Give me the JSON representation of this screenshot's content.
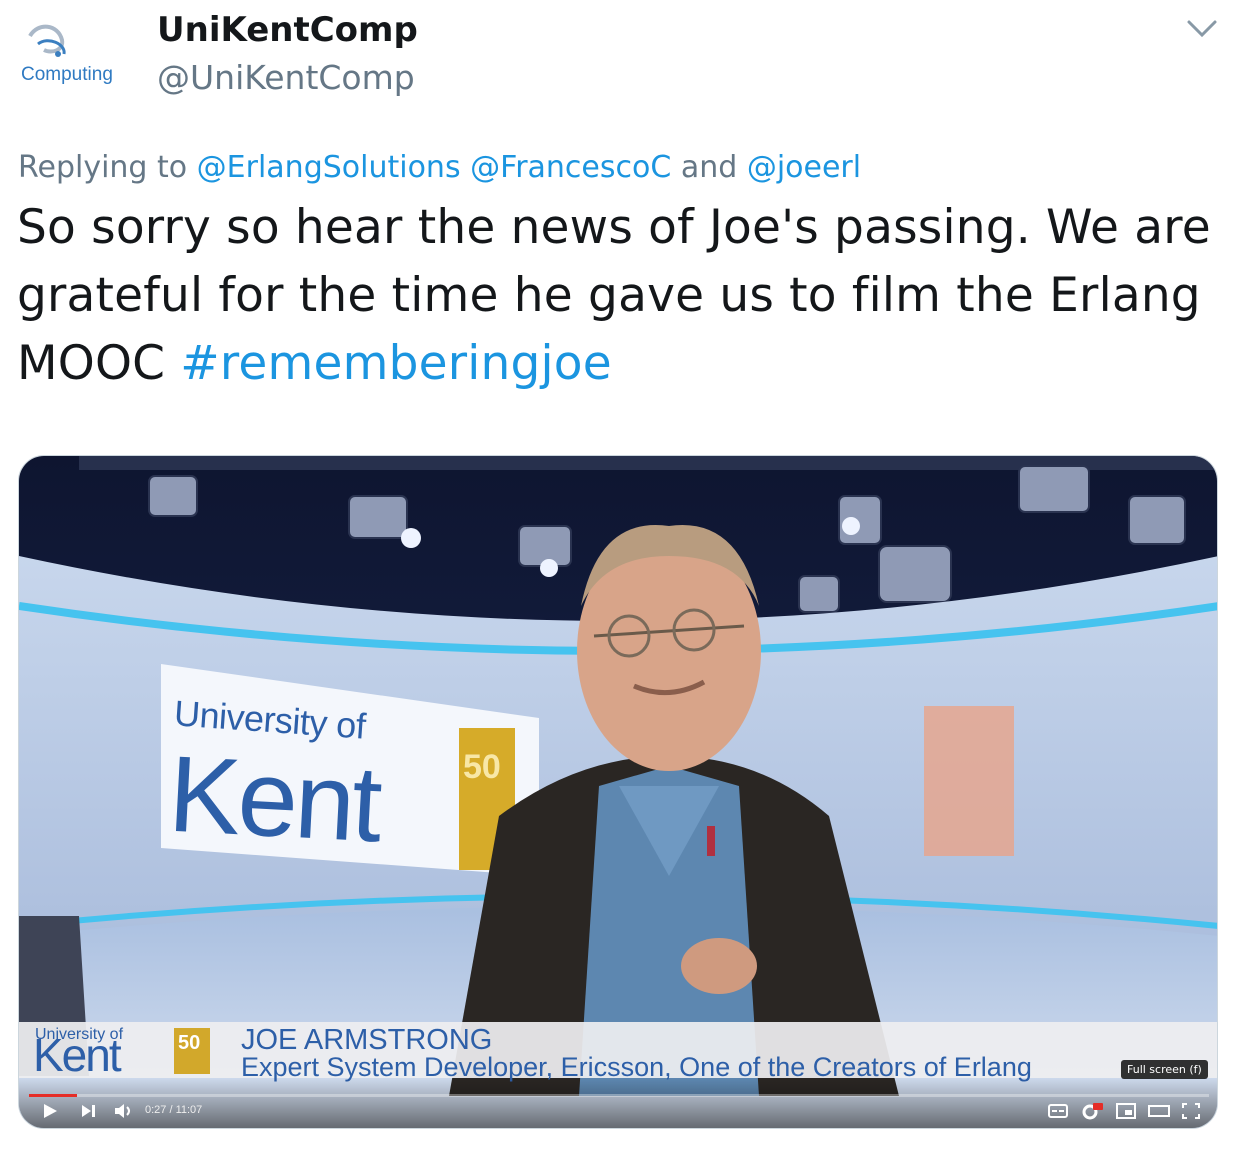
{
  "header": {
    "avatar_label": "Computing",
    "display_name": "UniKentComp",
    "handle": "@UniKentComp"
  },
  "reply": {
    "prefix": "Replying to ",
    "mentions": [
      "@ErlangSolutions",
      "@FrancescoC",
      "@joeerl"
    ],
    "joiner": " and "
  },
  "tweet": {
    "text": "So sorry so hear the news of Joe's passing. We are grateful for the time he gave us to film the Erlang MOOC ",
    "hashtag": "#rememberingjoe"
  },
  "video": {
    "sign_university": "University of",
    "sign_kent": "Kent",
    "sign_fifty": "50",
    "lower_third": {
      "univ": "University of",
      "kent": "Kent",
      "badge": "50",
      "name": "JOE ARMSTRONG",
      "title": "Expert System Developer, Ericsson, One of the Creators of Erlang"
    },
    "tooltip": "Full screen (f)",
    "time_readout": "0:27 / 11:07",
    "progress": 0.0405
  },
  "colors": {
    "link": "#1b95e0",
    "secondary_text": "#657786",
    "kent_blue": "#2d5fa8",
    "progress_red": "#e52d27"
  },
  "icons": [
    "chevron-down-icon",
    "play-icon",
    "next-icon",
    "volume-icon",
    "subtitles-icon",
    "settings-icon",
    "miniplayer-icon",
    "theater-icon",
    "fullscreen-icon"
  ]
}
